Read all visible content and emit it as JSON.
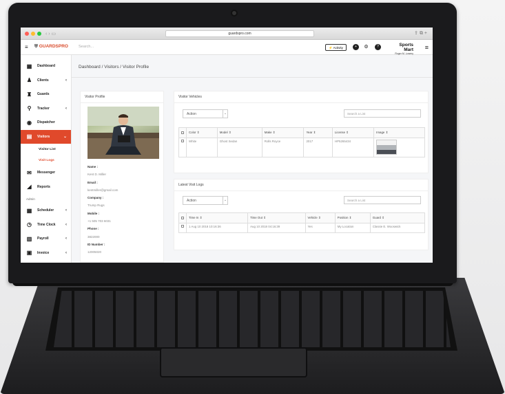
{
  "browser": {
    "url": "guardspro.com"
  },
  "header": {
    "logo_text": "GUARDSPRO",
    "search_placeholder": "Search...",
    "activity_label": "Activity",
    "company_name": "Sports Mart",
    "company_user": "Roger M. Lowery"
  },
  "sidebar": {
    "items": [
      {
        "label": "Dashboard"
      },
      {
        "label": "Clients"
      },
      {
        "label": "Guards"
      },
      {
        "label": "Tracker"
      },
      {
        "label": "Dispatcher"
      },
      {
        "label": "Visitors"
      },
      {
        "label": "Messenger"
      },
      {
        "label": "Reports"
      },
      {
        "label": "Scheduler"
      },
      {
        "label": "Time Clock"
      },
      {
        "label": "Payroll"
      },
      {
        "label": "Invoice"
      }
    ],
    "sub_items": [
      {
        "label": "Visitor List"
      },
      {
        "label": "Visit Logs"
      }
    ],
    "section_admin": "Admin"
  },
  "breadcrumb": {
    "part1": "Dashboard",
    "sep": "/",
    "part2": "Visitors",
    "part3": "Visitor Profile"
  },
  "profile": {
    "title": "Visitor Profile",
    "fields": [
      {
        "label": "Name :",
        "value": "Kent D. Miller"
      },
      {
        "label": "Email :",
        "value": "kentmiller@gmail.com"
      },
      {
        "label": "Company :",
        "value": "Trump Rugs"
      },
      {
        "label": "Mobile :",
        "value": "+1 505 703 6031"
      },
      {
        "label": "Phone :",
        "value": "3822000"
      },
      {
        "label": "ID Number :",
        "value": "12005020"
      }
    ]
  },
  "vehicles": {
    "title": "Visitor Vehicles",
    "action_label": "Action",
    "search_placeholder": "Search a List",
    "columns": [
      "Color ⇕",
      "Model ⇕",
      "Make ⇕",
      "Year ⇕",
      "License ⇕",
      "Image ⇕"
    ],
    "rows": [
      {
        "color": "White",
        "model": "Ghost Sedan",
        "make": "Rolls Royce",
        "year": "2017",
        "license": "HP5265434"
      }
    ]
  },
  "logs": {
    "title": "Latest Visit Logs",
    "action_label": "Action",
    "search_placeholder": "Search a List",
    "columns": [
      "Time In ⇕",
      "Time Out ⇕",
      "Vehicle ⇕",
      "Position ⇕",
      "Guard ⇕"
    ],
    "rows": [
      {
        "time_in": "1 Aug 10 2018 10:16:36",
        "time_out": "Aug 10 2018 04:16:39",
        "vehicle": "Yes",
        "position": "My Location",
        "guard": "Classie E. Wooswick"
      }
    ]
  },
  "colors": {
    "accent": "#e0492b",
    "active_nav": "#e0492b"
  }
}
